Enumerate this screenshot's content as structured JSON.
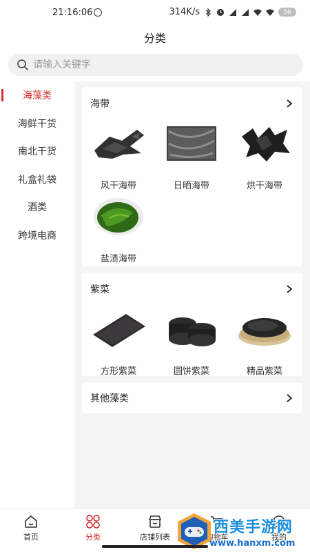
{
  "status_bar": {
    "time": "21:16:06",
    "speed": "314K/s",
    "battery": "56"
  },
  "header": {
    "title": "分类"
  },
  "search": {
    "placeholder": "请输入关键字"
  },
  "sidebar": {
    "items": [
      {
        "label": "海藻类",
        "active": true
      },
      {
        "label": "海鲜干货",
        "active": false
      },
      {
        "label": "南北干货",
        "active": false
      },
      {
        "label": "礼盒礼袋",
        "active": false
      },
      {
        "label": "酒类",
        "active": false
      },
      {
        "label": "跨境电商",
        "active": false
      }
    ]
  },
  "categories": [
    {
      "title": "海带",
      "items": [
        {
          "label": "风干海带",
          "icon": "dried-kelp-image"
        },
        {
          "label": "日晒海带",
          "icon": "sun-dried-kelp-image"
        },
        {
          "label": "烘干海带",
          "icon": "oven-dried-kelp-image"
        },
        {
          "label": "盐渍海带",
          "icon": "salted-kelp-image"
        }
      ]
    },
    {
      "title": "紫菜",
      "items": [
        {
          "label": "方形紫菜",
          "icon": "square-laver-image"
        },
        {
          "label": "圆饼紫菜",
          "icon": "round-laver-image"
        },
        {
          "label": "精品紫菜",
          "icon": "premium-laver-image"
        }
      ]
    },
    {
      "title": "其他藻类",
      "items": []
    }
  ],
  "bottom_nav": [
    {
      "label": "首页",
      "icon": "home-icon",
      "active": false
    },
    {
      "label": "分类",
      "icon": "category-grid-icon",
      "active": true
    },
    {
      "label": "店铺列表",
      "icon": "store-icon",
      "active": false
    },
    {
      "label": "购物车",
      "icon": "cart-icon",
      "active": false
    },
    {
      "label": "我的",
      "icon": "profile-icon",
      "active": false
    }
  ],
  "watermark": {
    "title": "西美手游网",
    "url": "www.hanxm.com"
  },
  "colors": {
    "accent": "#d62b2b",
    "background": "#f5f5f5"
  }
}
